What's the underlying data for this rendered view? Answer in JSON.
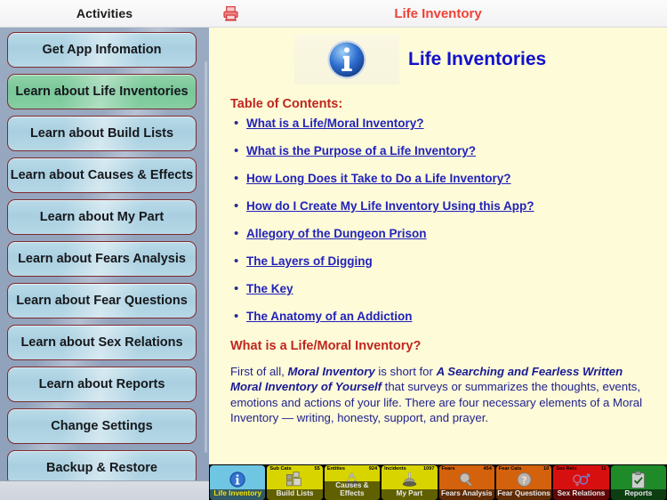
{
  "sidebar": {
    "header_title": "Activities",
    "items": [
      {
        "label": "Get App Infomation",
        "name": "sidebar-item-get-app-information",
        "selected": false
      },
      {
        "label": "Learn about Life Inventories",
        "name": "sidebar-item-learn-life-inventories",
        "selected": true
      },
      {
        "label": "Learn about Build Lists",
        "name": "sidebar-item-learn-build-lists",
        "selected": false
      },
      {
        "label": "Learn about Causes & Effects",
        "name": "sidebar-item-learn-causes-effects",
        "selected": false
      },
      {
        "label": "Learn about My Part",
        "name": "sidebar-item-learn-my-part",
        "selected": false
      },
      {
        "label": "Learn about Fears Analysis",
        "name": "sidebar-item-learn-fears-analysis",
        "selected": false
      },
      {
        "label": "Learn about Fear Questions",
        "name": "sidebar-item-learn-fear-questions",
        "selected": false
      },
      {
        "label": "Learn about Sex Relations",
        "name": "sidebar-item-learn-sex-relations",
        "selected": false
      },
      {
        "label": "Learn about Reports",
        "name": "sidebar-item-learn-reports",
        "selected": false
      },
      {
        "label": "Change Settings",
        "name": "sidebar-item-change-settings",
        "selected": false
      },
      {
        "label": "Backup & Restore",
        "name": "sidebar-item-backup-restore",
        "selected": false
      }
    ]
  },
  "header": {
    "title": "Life Inventory",
    "print_icon": "printer-icon",
    "title_color": "#ef4136"
  },
  "main": {
    "hero_icon": "info-icon",
    "hero_title": "Life Inventories",
    "hero_title_color": "#1111cc",
    "toc_heading": "Table of Contents:",
    "toc": [
      "What is a Life/Moral Inventory?",
      "What is the Purpose of a Life Inventory?",
      "How Long Does it Take to Do a Life Inventory?",
      "How do I Create My Life Inventory Using this App?",
      "Allegory of the Dungeon Prison",
      "The Layers of Digging",
      "The Key",
      "The Anatomy of an Addiction"
    ],
    "article_heading": "What is a Life/Moral Inventory?",
    "article": {
      "lead": "First of all, ",
      "em1": "Moral Inventory",
      "mid": " is short for ",
      "em2": "A Searching and Fearless Written Moral Inventory of Yourself",
      "tail": " that surveys or summarizes the thoughts, events, emotions and actions of your life. There are four necessary elements of a Moral Inventory — writing, honesty, support, and prayer."
    },
    "heading_color": "#c0261f",
    "link_color": "#2222bb",
    "page_background": "#fdfbd8"
  },
  "toolbar": {
    "items": [
      {
        "label": "Life Inventory",
        "badge_label": "",
        "badge_count": "",
        "color": "#6fc6e2",
        "icon": "info-icon",
        "active": true
      },
      {
        "label": "Build Lists",
        "badge_label": "Sub Cats",
        "badge_count": "55",
        "color": "#d8d400",
        "icon": "blocks-icon",
        "active": false
      },
      {
        "label": "Causes & Effects",
        "badge_label": "Entities",
        "badge_count": "924",
        "color": "#d8d400",
        "icon": "recycle-icon",
        "active": false
      },
      {
        "label": "My Part",
        "badge_label": "Incidents",
        "badge_count": "1097",
        "color": "#d8d400",
        "icon": "stamp-icon",
        "active": false
      },
      {
        "label": "Fears Analysis",
        "badge_label": "Fears",
        "badge_count": "454",
        "color": "#d4620c",
        "icon": "magnifier-icon",
        "active": false
      },
      {
        "label": "Fear Questions",
        "badge_label": "Fear Cats",
        "badge_count": "10",
        "color": "#d4620c",
        "icon": "question-icon",
        "active": false
      },
      {
        "label": "Sex Relations",
        "badge_label": "Sex Rels",
        "badge_count": "11",
        "color": "#d80f0f",
        "icon": "gender-icon",
        "active": false
      },
      {
        "label": "Reports",
        "badge_label": "",
        "badge_count": "",
        "color": "#1e8a28",
        "icon": "clipboard-icon",
        "active": false
      }
    ]
  }
}
